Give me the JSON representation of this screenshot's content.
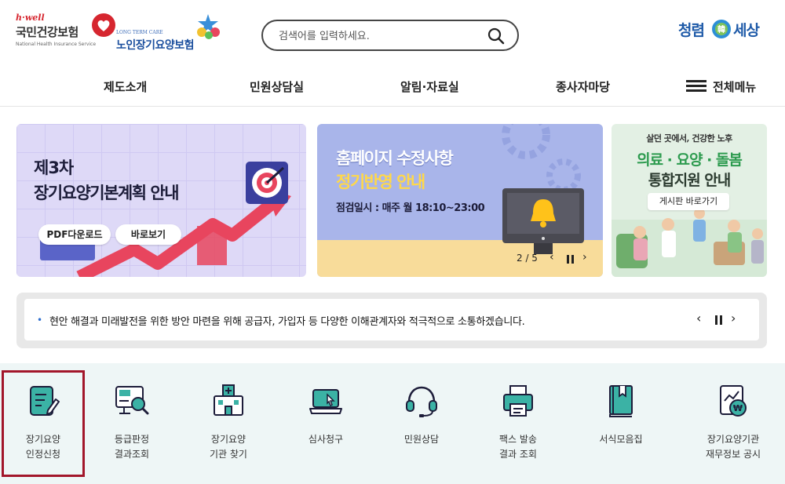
{
  "header": {
    "nhis_logo_tagline": "h·well",
    "nhis_logo_name": "국민건강보험",
    "nhis_logo_english": "National Health Insurance Service",
    "ltc_logo_small": "LONG TERM CARE",
    "ltc_logo_name": "노인장기요양보험",
    "search_placeholder": "검색어를 입력하세요.",
    "slogan_part1": "청렴",
    "slogan_badge": "韓",
    "slogan_part2": "세상"
  },
  "gnb": {
    "items": [
      "제도소개",
      "민원상담실",
      "알림·자료실",
      "종사자마당"
    ],
    "all_menu": "전체메뉴"
  },
  "banners": {
    "b1": {
      "line1": "제3차",
      "line2": "장기요양기본계획 안내",
      "btn1": "PDF다운로드",
      "btn2": "바로보기"
    },
    "b2": {
      "line1": "홈페이지 수정사항",
      "line2": "정기반영 안내",
      "line3": "점검일시 : 매주 월 18:10~23:00",
      "counter": "2 / 5"
    },
    "b3": {
      "line0": "살던 곳에서, 건강한 노후",
      "line1": "의료 · 요양 · 돌봄",
      "line2": "통합지원 안내",
      "link": "게시판 바로가기"
    }
  },
  "notice": {
    "text": "현안 해결과 미래발전을 위한 방안 마련을 위해 공급자, 가입자 등 다양한 이해관계자와 적극적으로 소통하겠습니다."
  },
  "quick_menu": [
    {
      "line1": "장기요양",
      "line2": "인정신청",
      "icon": "edit-document-icon",
      "selected": true
    },
    {
      "line1": "등급판정",
      "line2": "결과조회",
      "icon": "monitor-search-icon",
      "selected": false
    },
    {
      "line1": "장기요양",
      "line2": "기관 찾기",
      "icon": "hospital-building-icon",
      "selected": false
    },
    {
      "line1": "심사청구",
      "line2": "",
      "icon": "laptop-click-icon",
      "selected": false
    },
    {
      "line1": "민원상담",
      "line2": "",
      "icon": "headset-icon",
      "selected": false
    },
    {
      "line1": "팩스 발송",
      "line2": "결과 조회",
      "icon": "fax-icon",
      "selected": false
    },
    {
      "line1": "서식모음집",
      "line2": "",
      "icon": "book-icon",
      "selected": false
    },
    {
      "line1": "장기요양기관",
      "line2": "재무정보 공시",
      "icon": "finance-report-icon",
      "selected": false
    }
  ],
  "colors": {
    "accent_teal": "#3bb2a5",
    "brand_blue": "#1b4f9e",
    "selected_outline": "#a2162a",
    "quick_bg": "#eef6f6"
  }
}
